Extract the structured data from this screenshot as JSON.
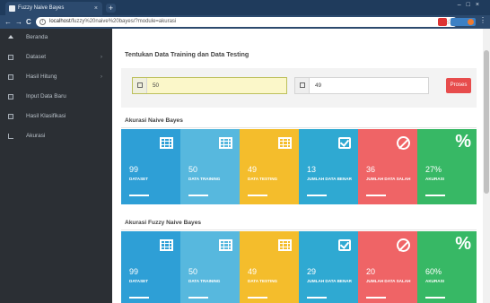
{
  "browser": {
    "tab_title": "Fuzzy Naive Bayes",
    "tab_close": "×",
    "new_tab": "+",
    "window_controls": [
      "–",
      "□",
      "×"
    ],
    "url_host": "localhost",
    "url_path": "/fuzzy%20naive%20bayes/?module=akurasi",
    "back": "←",
    "forward": "→",
    "reload": "C",
    "star": "☆",
    "menu": "⋮"
  },
  "sidebar": {
    "items": [
      {
        "label": "Beranda",
        "icon": "home-icon",
        "chevron": false
      },
      {
        "label": "Dataset",
        "icon": "table-icon",
        "chevron": true
      },
      {
        "label": "Hasil Hitung",
        "icon": "table-icon",
        "chevron": true
      },
      {
        "label": "Input Data Baru",
        "icon": "table-icon",
        "chevron": false
      },
      {
        "label": "Hasil Klasifikasi",
        "icon": "table-icon",
        "chevron": false
      },
      {
        "label": "Akurasi",
        "icon": "line-chart-icon",
        "chevron": false
      }
    ],
    "chevron_glyph": "›"
  },
  "main": {
    "title": "Tentukan Data Training dan Data Testing",
    "training_value": "50",
    "testing_value": "49",
    "button_label": "Proses",
    "panels": [
      {
        "title": "Akurasi Naive Bayes",
        "tiles": [
          {
            "value": "99",
            "label": "DATASET",
            "icon": "grid-icon",
            "color": "#2e9fd6"
          },
          {
            "value": "50",
            "label": "DATA TRAINING",
            "icon": "grid-icon",
            "color": "#57b8de"
          },
          {
            "value": "49",
            "label": "DATA TESTING",
            "icon": "grid-icon",
            "color": "#f4bd2c"
          },
          {
            "value": "13",
            "label": "JUMLAH DATA BENAR",
            "icon": "check-square-icon",
            "color": "#2fa9d2"
          },
          {
            "value": "36",
            "label": "JUMLAH DATA SALAH",
            "icon": "ban-icon",
            "color": "#ef6466"
          },
          {
            "value": "27%",
            "label": "AKURASI",
            "icon": "percent-icon",
            "color": "#37b865"
          }
        ]
      },
      {
        "title": "Akurasi Fuzzy Naive Bayes",
        "tiles": [
          {
            "value": "99",
            "label": "DATASET",
            "icon": "grid-icon",
            "color": "#2e9fd6"
          },
          {
            "value": "50",
            "label": "DATA TRAINING",
            "icon": "grid-icon",
            "color": "#57b8de"
          },
          {
            "value": "49",
            "label": "DATA TESTING",
            "icon": "grid-icon",
            "color": "#f4bd2c"
          },
          {
            "value": "29",
            "label": "JUMLAH DATA BENAR",
            "icon": "check-square-icon",
            "color": "#2fa9d2"
          },
          {
            "value": "20",
            "label": "JUMLAH DATA SALAH",
            "icon": "ban-icon",
            "color": "#ef6466"
          },
          {
            "value": "60%",
            "label": "AKURASI",
            "icon": "percent-icon",
            "color": "#37b865"
          }
        ]
      }
    ]
  }
}
